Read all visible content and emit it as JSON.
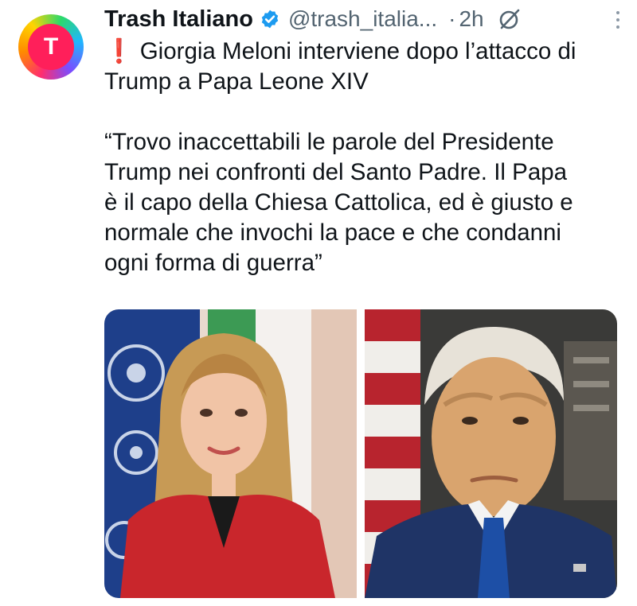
{
  "post": {
    "author_name": "Trash Italiano",
    "handle": "@trash_italia...",
    "separator": "·",
    "time": "2h",
    "avatar_letter": "T",
    "headline": "Giorgia Meloni interviene dopo l’attacco di Trump a Papa Leone XIV",
    "quote_lines": [
      "“Trovo inaccettabili le parole del Presidente",
      "Trump nei confronti del Santo Padre. Il Papa",
      "è il capo della Chiesa Cattolica, ed è giusto e",
      "normale che invochi la pace e che condanni",
      "ogni forma di guerra”"
    ]
  },
  "icons": {
    "verified": "verified-badge-icon",
    "grok": "grok-icon",
    "more": "more-options-icon",
    "exclamation": "exclamation-icon"
  },
  "colors": {
    "text": "#0f1419",
    "secondary": "#536471",
    "verified": "#1d9bf0",
    "exclamation": "#e0245e"
  }
}
